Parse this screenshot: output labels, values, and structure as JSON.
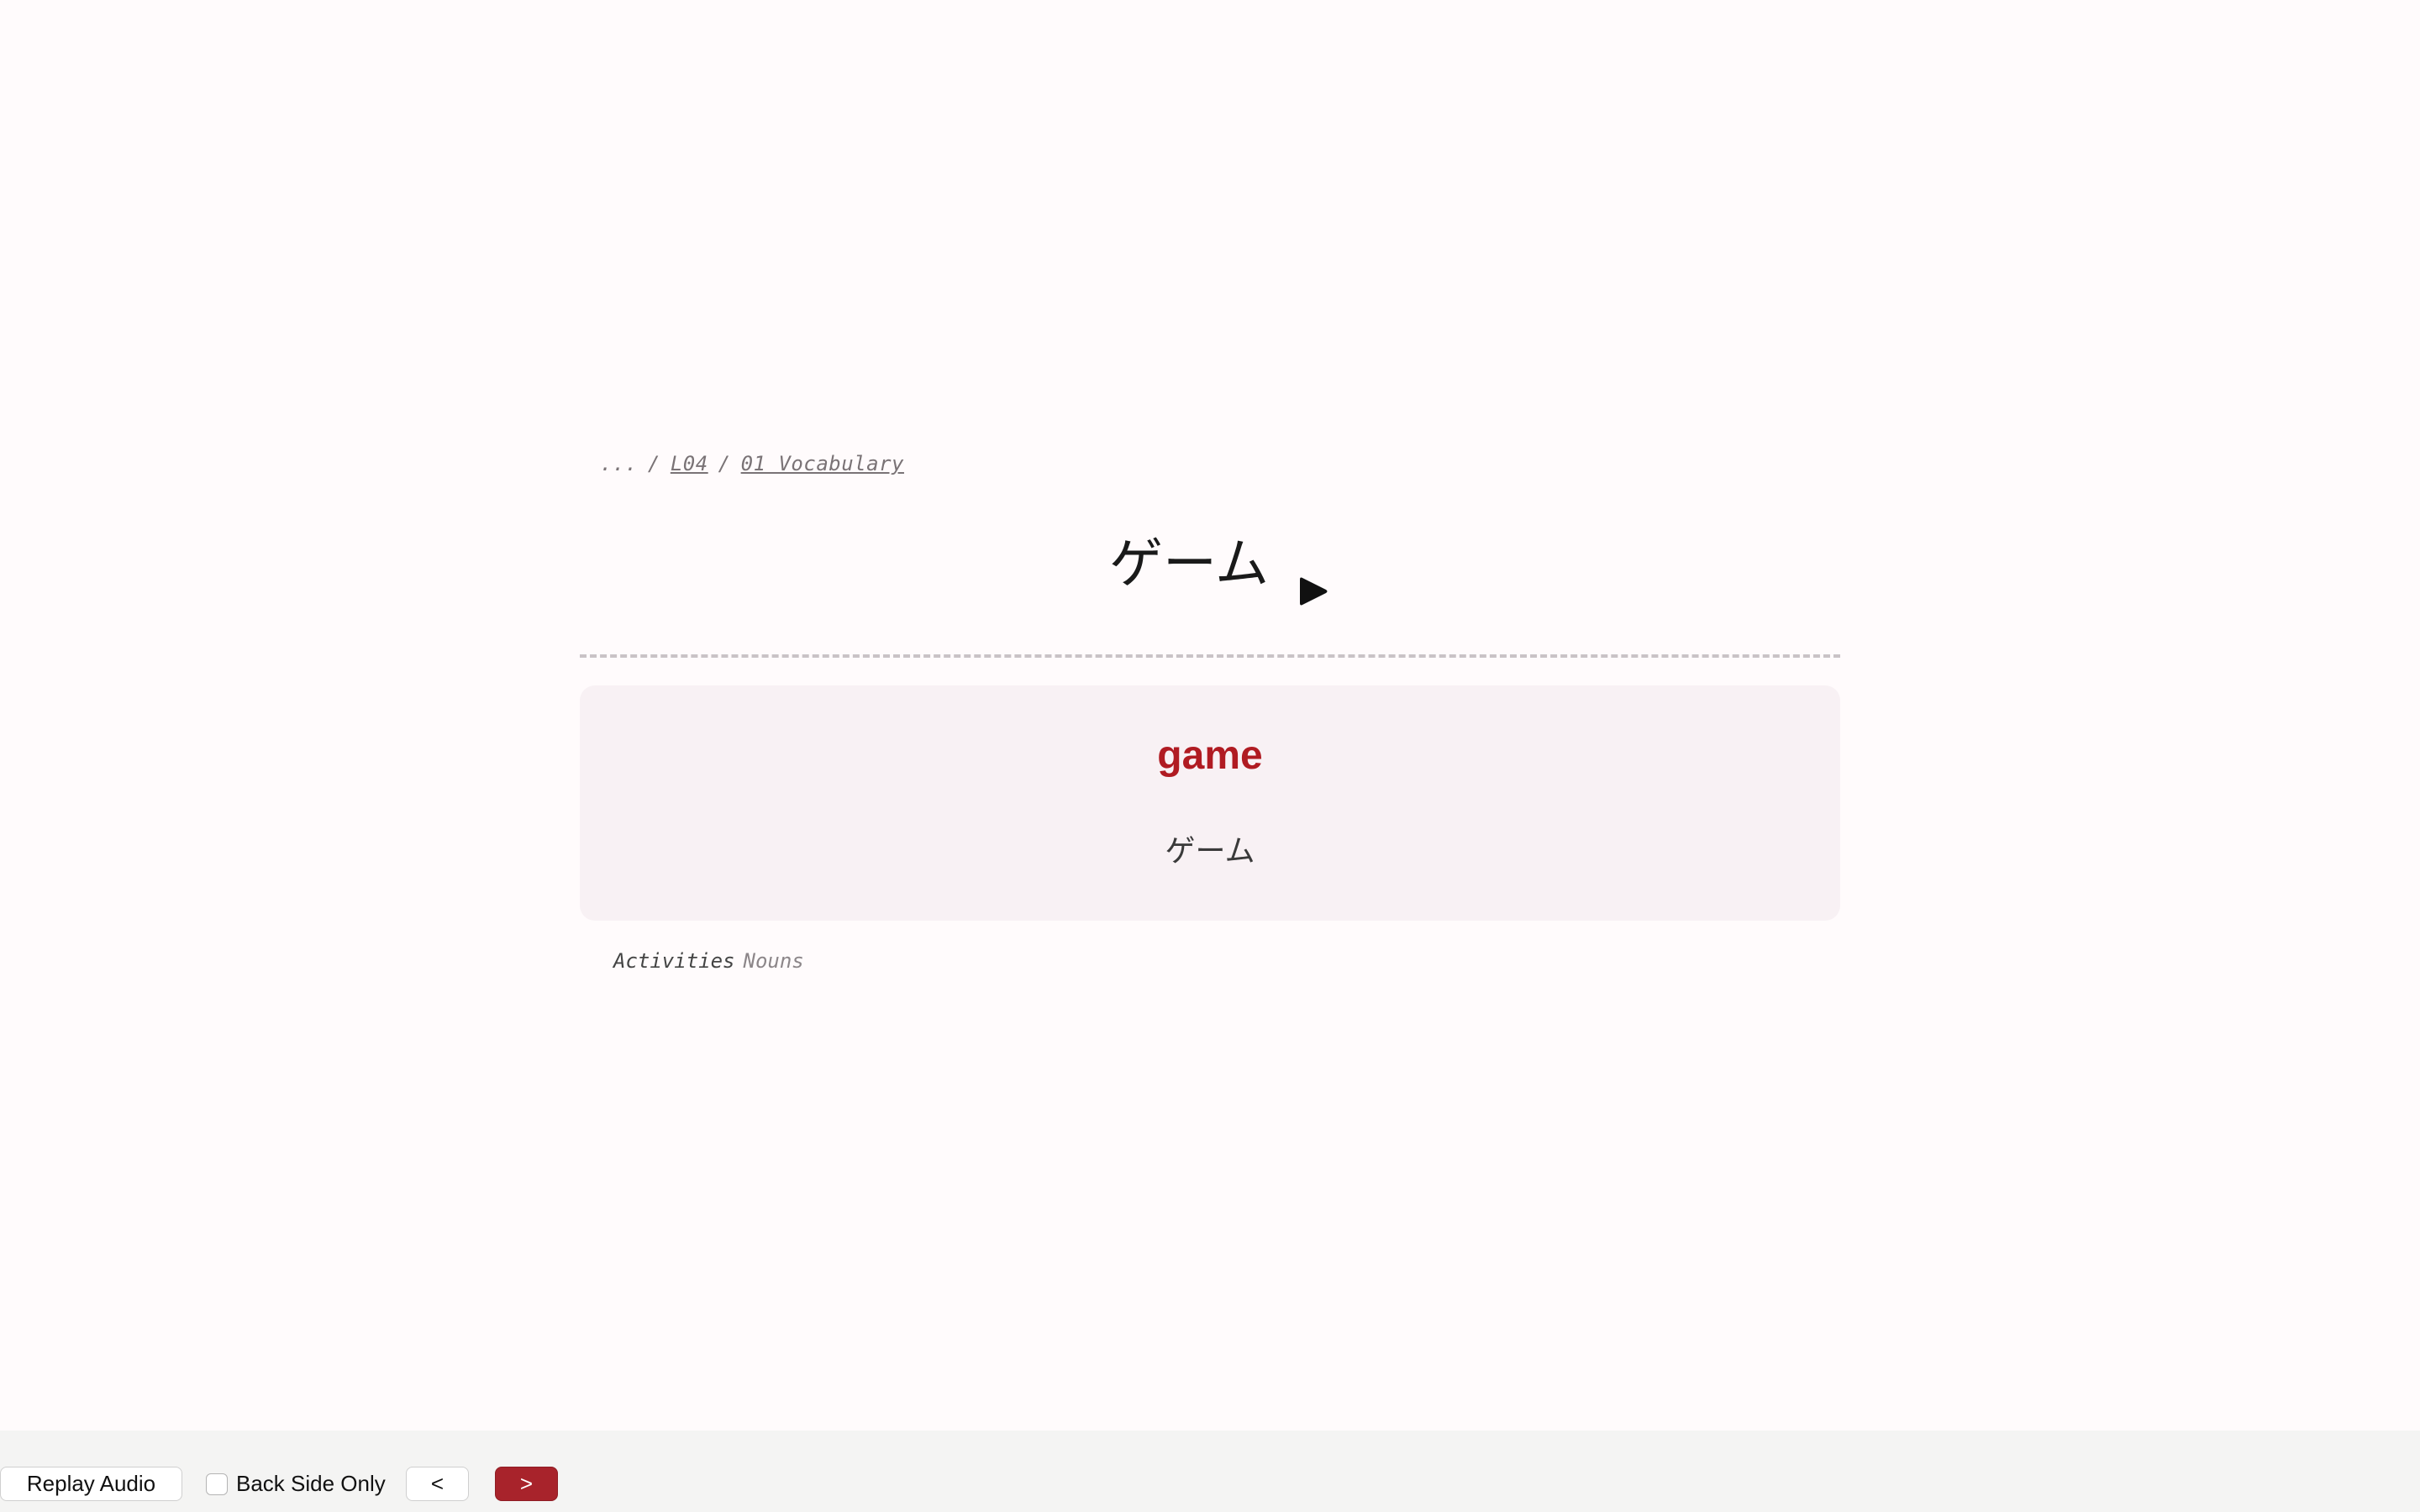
{
  "breadcrumb": {
    "ellipsis": "...",
    "separator": "/",
    "items": [
      "L04",
      "01 Vocabulary"
    ]
  },
  "card": {
    "front": "ゲーム",
    "play_icon": "play-icon",
    "meaning": "game",
    "reading": "ゲーム",
    "tags": {
      "primary": "Activities",
      "secondary": "Nouns"
    }
  },
  "toolbar": {
    "replay_label": "Replay Audio",
    "back_side_only_label": "Back Side Only",
    "back_side_only_checked": false,
    "prev_label": "<",
    "next_label": ">"
  },
  "colors": {
    "accent": "#b01b22",
    "next_button": "#a8232b",
    "page_background": "#fffbfc",
    "back_panel": "#f8f1f4"
  }
}
